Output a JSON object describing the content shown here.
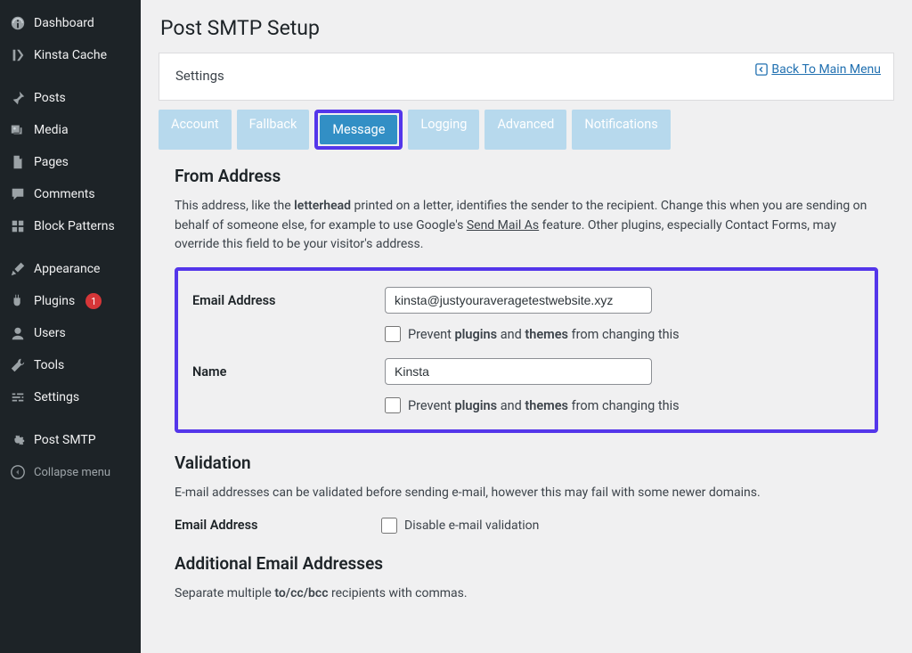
{
  "sidebar": {
    "items": [
      {
        "label": "Dashboard"
      },
      {
        "label": "Kinsta Cache"
      },
      {
        "label": "Posts"
      },
      {
        "label": "Media"
      },
      {
        "label": "Pages"
      },
      {
        "label": "Comments"
      },
      {
        "label": "Block Patterns"
      },
      {
        "label": "Appearance"
      },
      {
        "label": "Plugins",
        "badge": "1"
      },
      {
        "label": "Users"
      },
      {
        "label": "Tools"
      },
      {
        "label": "Settings"
      },
      {
        "label": "Post SMTP"
      },
      {
        "label": "Collapse menu"
      }
    ]
  },
  "page": {
    "title": "Post SMTP Setup",
    "settings_label": "Settings",
    "back_link": "Back To Main Menu"
  },
  "tabs": {
    "account": "Account",
    "fallback": "Fallback",
    "message": "Message",
    "logging": "Logging",
    "advanced": "Advanced",
    "notifications": "Notifications"
  },
  "from_address": {
    "heading": "From Address",
    "desc_pre": "This address, like the ",
    "desc_bold1": "letterhead",
    "desc_mid1": " printed on a letter, identifies the sender to the recipient. Change this when you are sending on behalf of someone else, for example to use Google's ",
    "desc_link": "Send Mail As",
    "desc_post": " feature. Other plugins, especially Contact Forms, may override this field to be your visitor's address.",
    "email_label": "Email Address",
    "email_value": "kinsta@justyouraveragetestwebsite.xyz",
    "prevent_pre": "Prevent ",
    "prevent_b1": "plugins",
    "prevent_mid": " and ",
    "prevent_b2": "themes",
    "prevent_post": " from changing this",
    "name_label": "Name",
    "name_value": "Kinsta"
  },
  "validation": {
    "heading": "Validation",
    "desc": "E-mail addresses can be validated before sending e-mail, however this may fail with some newer domains.",
    "email_label": "Email Address",
    "disable_label": "Disable e-mail validation"
  },
  "additional": {
    "heading": "Additional Email Addresses",
    "desc_pre": "Separate multiple ",
    "desc_b": "to/cc/bcc",
    "desc_post": " recipients with commas."
  }
}
